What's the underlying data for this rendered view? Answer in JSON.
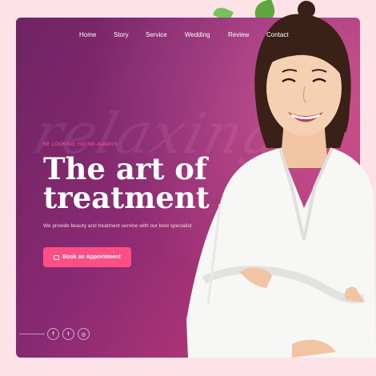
{
  "nav": {
    "items": [
      {
        "label": "Home"
      },
      {
        "label": "Story"
      },
      {
        "label": "Service"
      },
      {
        "label": "Wedding"
      },
      {
        "label": "Review"
      },
      {
        "label": "Contact"
      }
    ]
  },
  "hero": {
    "background_script": "relaxing",
    "tagline": "BE LOOKING YOUNG ALWAYS",
    "title_line1": "The art of",
    "title_line2": "treatment",
    "description": "We provide beauty and treatment service with our best specialist",
    "cta_label": "Book an Appointment"
  },
  "social": {
    "icons": [
      "facebook-icon",
      "twitter-icon",
      "instagram-icon"
    ],
    "facebook_glyph": "f",
    "twitter_glyph": "t",
    "instagram_glyph": "◎"
  },
  "colors": {
    "page_bg": "#fde3e8",
    "card_gradient_start": "#6e2463",
    "card_gradient_end": "#c94a86",
    "accent": "#ff4f86",
    "tagline": "#ff5e9a"
  }
}
